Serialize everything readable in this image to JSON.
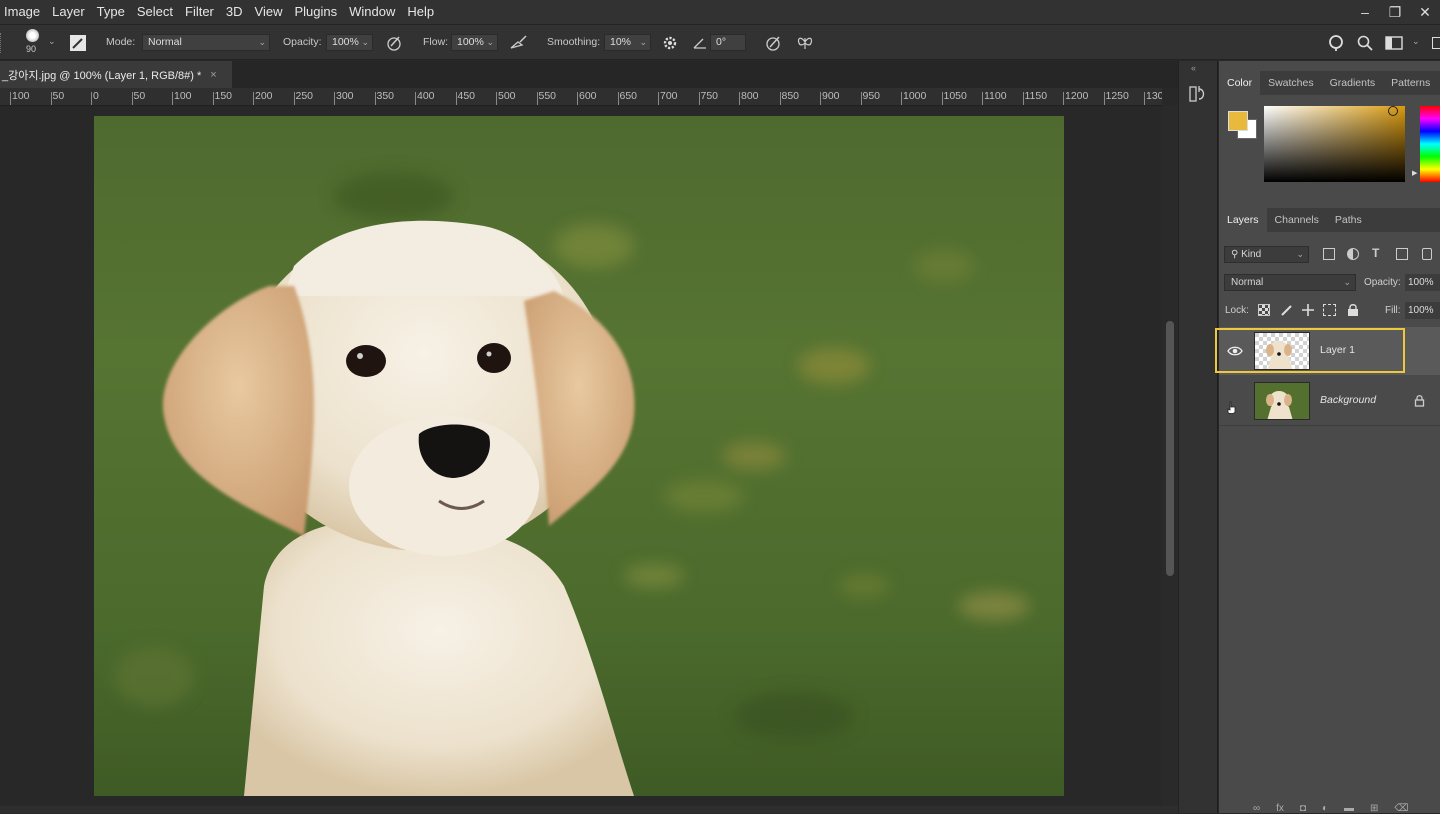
{
  "menu": {
    "items": [
      "Image",
      "Layer",
      "Type",
      "Select",
      "Filter",
      "3D",
      "View",
      "Plugins",
      "Window",
      "Help"
    ]
  },
  "window_controls": [
    "–",
    "❐",
    "✕"
  ],
  "options": {
    "brush_size": "90",
    "mode_label": "Mode:",
    "mode_value": "Normal",
    "opacity_label": "Opacity:",
    "opacity_value": "100%",
    "flow_label": "Flow:",
    "flow_value": "100%",
    "smoothing_label": "Smoothing:",
    "smoothing_value": "10%",
    "angle_value": "0°"
  },
  "document_tab": {
    "title": "_강아지.jpg @ 100% (Layer 1, RGB/8#) *",
    "close": "×"
  },
  "ruler": {
    "labels": [
      "100",
      "50",
      "0",
      "50",
      "100",
      "150",
      "200",
      "250",
      "300",
      "350",
      "400",
      "450",
      "500",
      "550",
      "600",
      "650",
      "700",
      "750",
      "800",
      "850",
      "900",
      "950",
      "1000",
      "1050",
      "1100",
      "1150",
      "1200",
      "1250",
      "130"
    ]
  },
  "color_panel": {
    "tabs": [
      "Color",
      "Swatches",
      "Gradients",
      "Patterns"
    ],
    "foreground_color": "#e8b93c",
    "background_color": "#ffffff"
  },
  "layers_panel": {
    "tabs": [
      "Layers",
      "Channels",
      "Paths"
    ],
    "filter_kind": "Kind",
    "blend_mode": "Normal",
    "opacity_label": "Opacity:",
    "opacity_value": "100%",
    "lock_label": "Lock:",
    "fill_label": "Fill:",
    "fill_value": "100%",
    "layers": [
      {
        "name": "Layer 1",
        "visible": true,
        "selected": true
      },
      {
        "name": "Background",
        "visible": false,
        "locked": true
      }
    ]
  },
  "colors": {
    "selection_highlight": "#f0c83c",
    "panel_bg": "#4a4a4a",
    "app_bg": "#282828"
  }
}
